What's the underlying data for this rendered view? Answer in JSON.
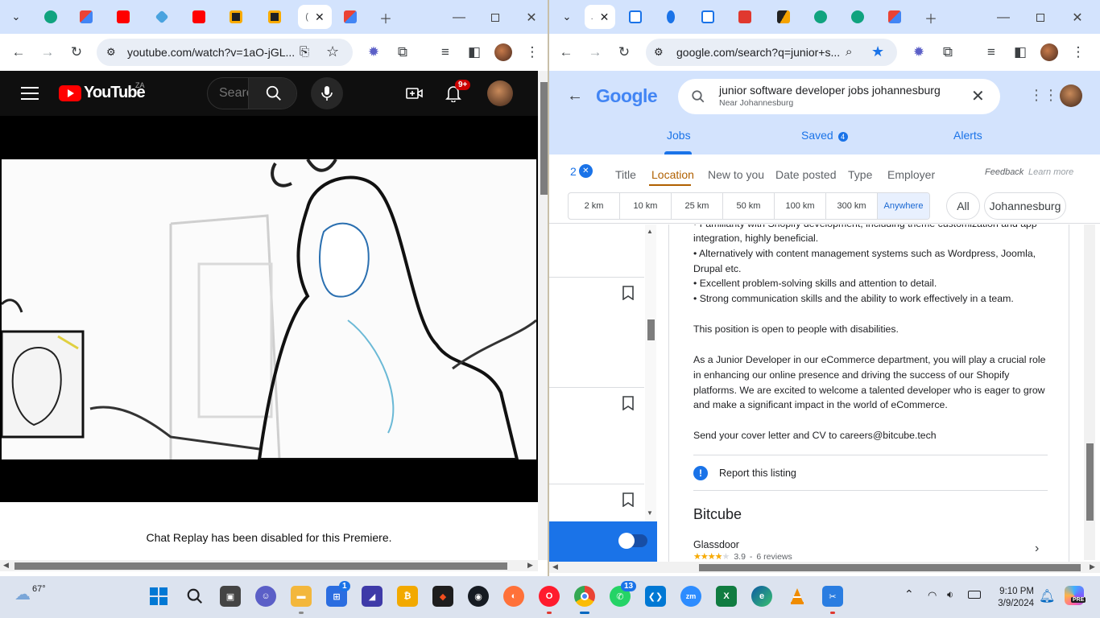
{
  "left": {
    "tab_indicator": "(",
    "url": "youtube.com/watch?v=1aO-jGL...",
    "youtube": {
      "logo_text": "YouTube",
      "region": "ZA",
      "search_placeholder": "Search",
      "notification_badge": "9+",
      "chat_replay_text": "Chat Replay has been disabled for this Premiere."
    }
  },
  "right": {
    "tab_indicator": ".",
    "url": "google.com/search?q=junior+s...",
    "google": {
      "logo": "Google",
      "query": "junior software developer jobs johannesburg",
      "location_hint": "Near Johannesburg",
      "tabs": {
        "jobs": "Jobs",
        "saved": "Saved",
        "saved_count": "4",
        "alerts": "Alerts"
      },
      "filter_count": "2",
      "filters": [
        "Title",
        "Location",
        "New to you",
        "Date posted",
        "Type",
        "Employer"
      ],
      "feedback": "Feedback",
      "learn_more": "Learn more",
      "distances": [
        "2 km",
        "10 km",
        "25 km",
        "50 km",
        "100 km",
        "300 km",
        "Anywhere"
      ],
      "selected_distance": "Anywhere",
      "place_all": "All",
      "place_city": "Johannesburg",
      "detail": {
        "cut_line": "• Familiarity with Shopify development, including theme customization and app",
        "lines": [
          "integration, highly beneficial.",
          "• Alternatively with content management systems such as Wordpress, Joomla, Drupal etc.",
          "• Excellent problem-solving skills and attention to detail.",
          "• Strong communication skills and the ability to work effectively in a team."
        ],
        "disability": "This position is open to people with disabilities.",
        "role": "As a Junior Developer in our eCommerce department, you will play a crucial role in enhancing our online presence and driving the success of our Shopify platforms. We are excited to welcome a talented developer who is eager to grow and make a significant impact in the world of eCommerce.",
        "apply": "Send your cover letter and CV to careers@bitcube.tech",
        "report": "Report this listing",
        "company": "Bitcube",
        "source": "Glassdoor",
        "rating": "3.9",
        "rating_fraction": 0.78,
        "reviews": "6 reviews"
      }
    }
  },
  "taskbar": {
    "weather": "67°",
    "store_badge": "1",
    "whatsapp_badge": "13",
    "time": "9:10 PM",
    "date": "3/9/2024",
    "copilot_label": "PRE"
  },
  "colors": {
    "google_blue": "#1a73e8",
    "tab_strip": "#d3e3fd",
    "youtube_red": "#ff0000",
    "youtube_bar": "#0f0f0f"
  }
}
